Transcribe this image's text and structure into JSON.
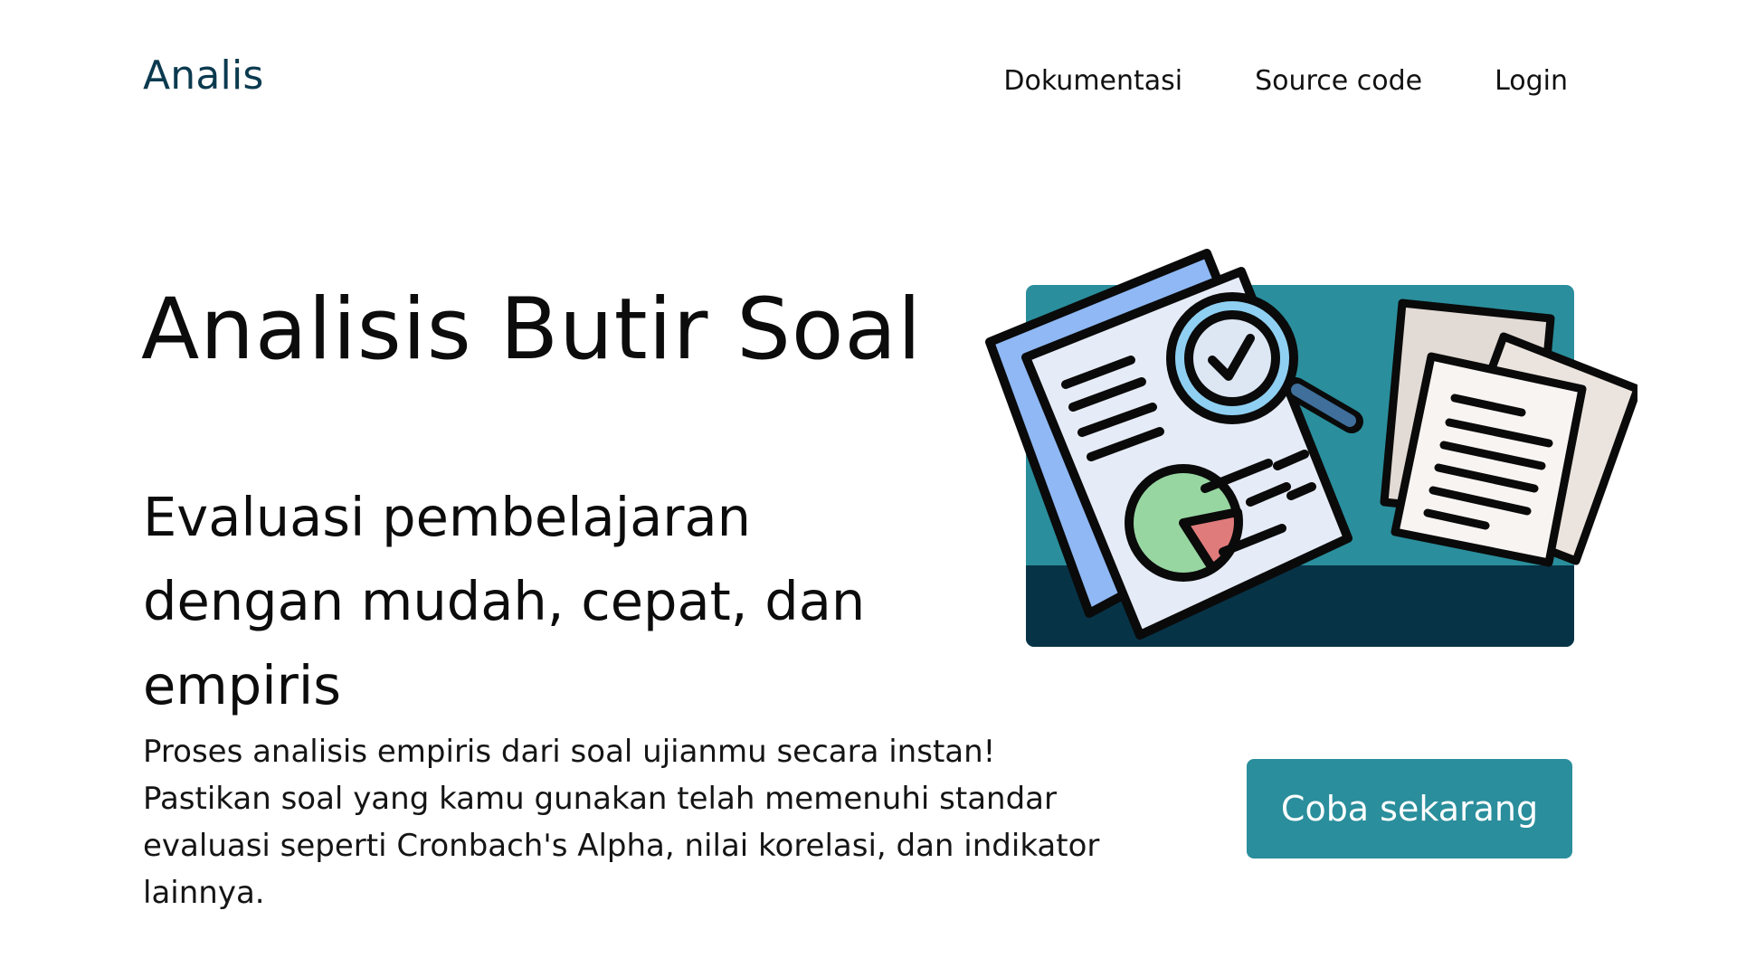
{
  "header": {
    "brand": "Analis",
    "nav": {
      "docs": "Dokumentasi",
      "source": "Source code",
      "login": "Login"
    }
  },
  "hero": {
    "title": "Analisis Butir Soal",
    "subtitle": "Evaluasi pembelajaran dengan mudah, cepat, dan empiris",
    "description_line1": "Proses analisis empiris dari soal ujianmu secara instan!",
    "description_line2": "Pastikan soal yang kamu gunakan telah memenuhi standar evaluasi seperti Cronbach's Alpha, nilai korelasi, dan indikator lainnya.",
    "cta_label": "Coba sekarang"
  },
  "illustration": {
    "icon": "document-analysis-icon",
    "colors": {
      "teal": "#2a8e9c",
      "navy": "#073346",
      "paper": "#e6ecf7",
      "blue": "#8fb8f4",
      "green": "#97d6a1",
      "red": "#e07b7b",
      "beige": "#e2dad4"
    }
  },
  "colors": {
    "brand": "#0b3a4f",
    "accent": "#2a8e9c",
    "text": "#111111"
  }
}
